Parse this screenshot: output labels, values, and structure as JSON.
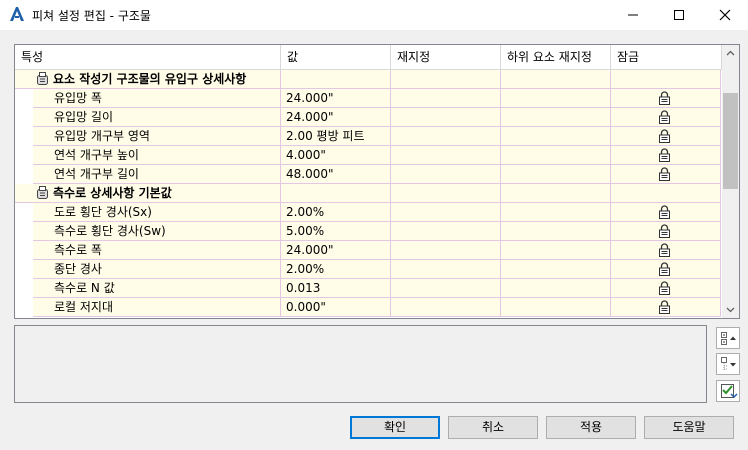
{
  "window": {
    "title": "피쳐 설정 편집 - 구조물"
  },
  "grid": {
    "headers": [
      "특성",
      "값",
      "재지정",
      "하위 요소 재지정",
      "잠금"
    ],
    "groups": [
      {
        "label": "요소 작성기 구조물의 유입구 상세사항",
        "rows": [
          {
            "name": "유입망 폭",
            "value": "24.000\"",
            "locked": true
          },
          {
            "name": "유입망 길이",
            "value": "24.000\"",
            "locked": true
          },
          {
            "name": "유입망 개구부 영역",
            "value": "2.00 평방 피트",
            "locked": true
          },
          {
            "name": "연석 개구부 높이",
            "value": "4.000\"",
            "locked": true
          },
          {
            "name": "연석 개구부 길이",
            "value": "48.000\"",
            "locked": true
          }
        ]
      },
      {
        "label": "측수로 상세사항 기본값",
        "rows": [
          {
            "name": "도로 횡단 경사(Sx)",
            "value": "2.00%",
            "locked": true
          },
          {
            "name": "측수로 횡단 경사(Sw)",
            "value": "5.00%",
            "locked": true
          },
          {
            "name": "측수로 폭",
            "value": "24.000\"",
            "locked": true
          },
          {
            "name": "종단 경사",
            "value": "2.00%",
            "locked": true
          },
          {
            "name": "측수로 N 값",
            "value": "0.013",
            "locked": true
          },
          {
            "name": "로컬 저지대",
            "value": "0.000\"",
            "locked": true
          }
        ]
      }
    ]
  },
  "buttons": {
    "ok": "확인",
    "cancel": "취소",
    "apply": "적용",
    "help": "도움말"
  },
  "colors": {
    "row_bg": "#fffde8",
    "grid_line": "#e4c7e4",
    "accent": "#0078d7"
  }
}
